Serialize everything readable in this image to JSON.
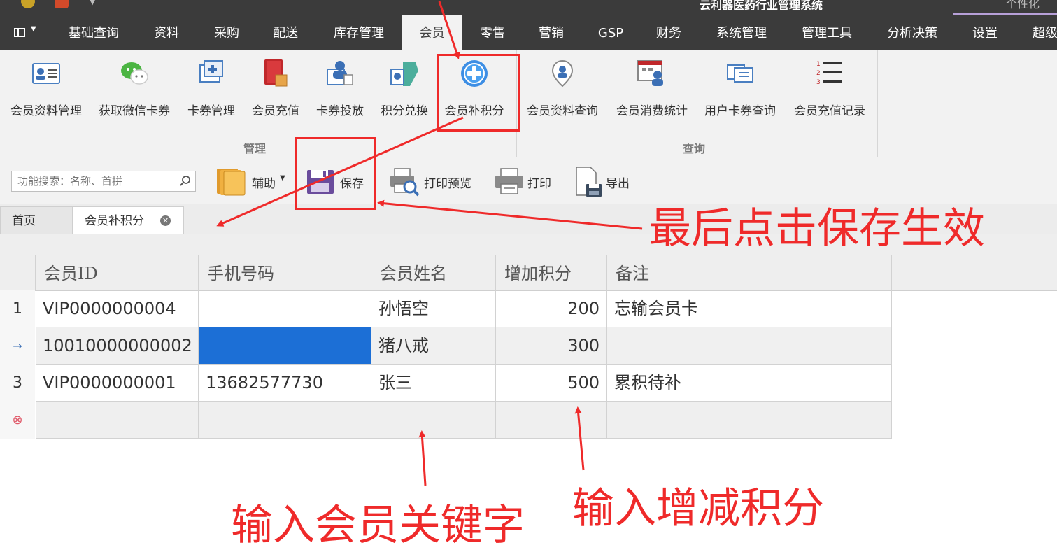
{
  "app": {
    "title": "云利器医药行业管理系统",
    "personalize_label": "个性化"
  },
  "menu": {
    "items": [
      {
        "label": "基础查询"
      },
      {
        "label": "资料"
      },
      {
        "label": "采购"
      },
      {
        "label": "配送"
      },
      {
        "label": "库存管理"
      },
      {
        "label": "会员",
        "active": true
      },
      {
        "label": "零售"
      },
      {
        "label": "营销"
      },
      {
        "label": "GSP"
      },
      {
        "label": "财务"
      },
      {
        "label": "系统管理"
      },
      {
        "label": "管理工具"
      },
      {
        "label": "分析决策"
      },
      {
        "label": "设置"
      },
      {
        "label": "超级"
      }
    ]
  },
  "ribbon": {
    "groups": [
      {
        "label": "管理"
      },
      {
        "label": "查询"
      }
    ],
    "buttons": [
      {
        "label": "会员资料管理",
        "icon": "member-card-icon"
      },
      {
        "label": "获取微信卡券",
        "icon": "wechat-icon"
      },
      {
        "label": "卡券管理",
        "icon": "coupon-manage-icon"
      },
      {
        "label": "会员充值",
        "icon": "recharge-icon"
      },
      {
        "label": "卡券投放",
        "icon": "coupon-deliver-icon"
      },
      {
        "label": "积分兑换",
        "icon": "points-exchange-icon"
      },
      {
        "label": "会员补积分",
        "icon": "plus-circle-icon"
      },
      {
        "label": "会员资料查询",
        "icon": "location-pin-icon"
      },
      {
        "label": "会员消费统计",
        "icon": "consumption-stats-icon"
      },
      {
        "label": "用户卡券查询",
        "icon": "user-coupon-icon"
      },
      {
        "label": "会员充值记录",
        "icon": "numbered-list-icon"
      }
    ]
  },
  "toolbar": {
    "search_placeholder": "功能搜索：名称、首拼",
    "assist_label": "辅助",
    "save_label": "保存",
    "print_preview_label": "打印预览",
    "print_label": "打印",
    "export_label": "导出"
  },
  "tabs": [
    {
      "label": "首页"
    },
    {
      "label": "会员补积分",
      "active": true
    }
  ],
  "grid": {
    "columns": [
      "会员ID",
      "手机号码",
      "会员姓名",
      "增加积分",
      "备注"
    ],
    "rows": [
      {
        "indicator": "1",
        "member_id": "VIP0000000004",
        "phone": "",
        "name": "孙悟空",
        "points": "200",
        "note": "忘输会员卡"
      },
      {
        "indicator": "→",
        "member_id": "10010000000002",
        "phone": "",
        "name": "猪八戒",
        "points": "300",
        "note": ""
      },
      {
        "indicator": "3",
        "member_id": "VIP0000000001",
        "phone": "13682577730",
        "name": "张三",
        "points": "500",
        "note": "累积待补"
      }
    ],
    "new_row_indicator": "⊗"
  },
  "annotations": {
    "save_hint": "最后点击保存生效",
    "member_hint": "输入会员关键字",
    "points_hint": "输入增减积分"
  },
  "colors": {
    "annotation": "#ef2a2a",
    "menubar": "#3b3b3b",
    "selection": "#1c6fd6"
  }
}
